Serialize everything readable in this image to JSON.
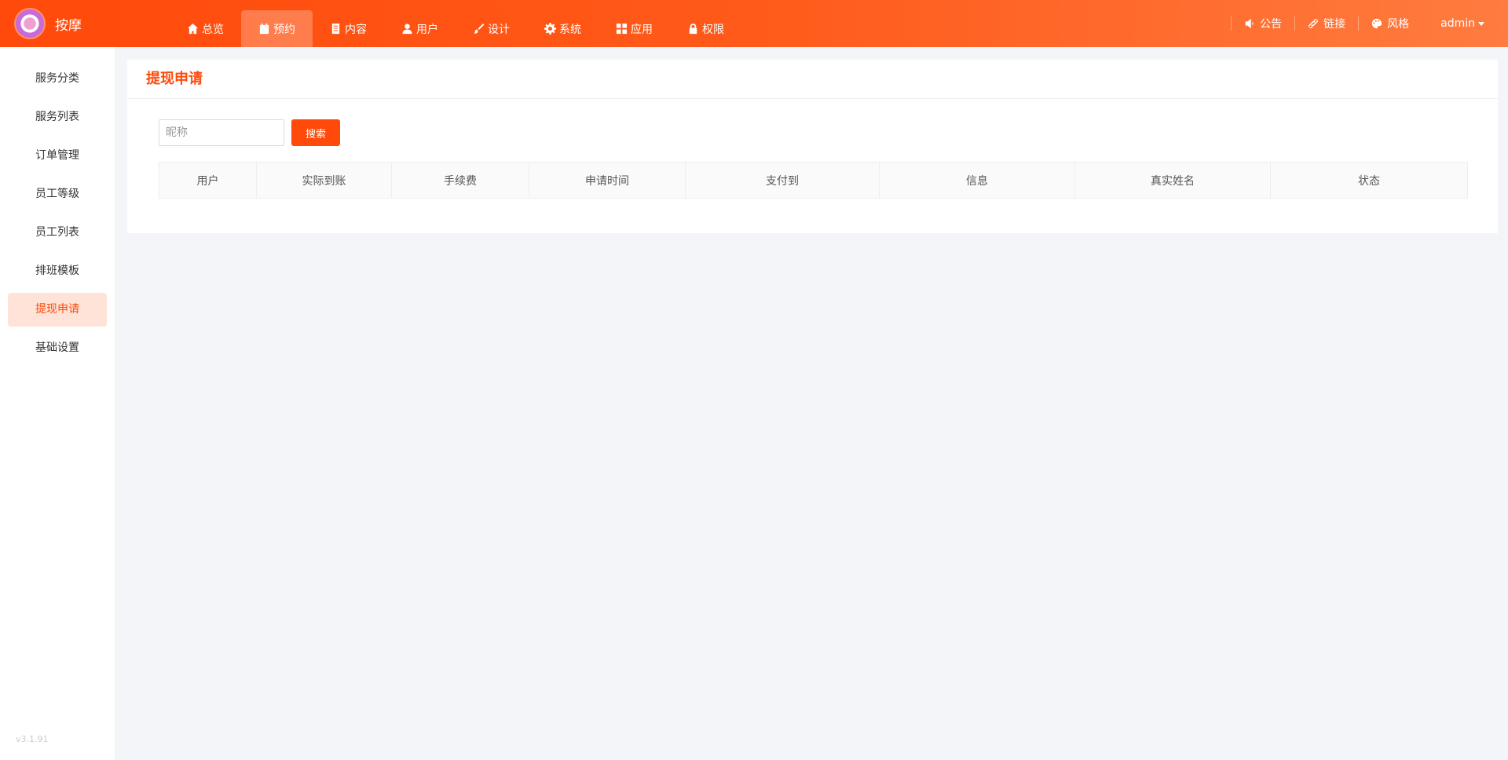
{
  "header": {
    "brand": "按摩",
    "nav": [
      {
        "label": "总览",
        "icon": "home-icon"
      },
      {
        "label": "预约",
        "icon": "calendar-icon",
        "active": true
      },
      {
        "label": "内容",
        "icon": "document-icon"
      },
      {
        "label": "用户",
        "icon": "user-icon"
      },
      {
        "label": "设计",
        "icon": "brush-icon"
      },
      {
        "label": "系统",
        "icon": "gear-icon"
      },
      {
        "label": "应用",
        "icon": "grid-icon"
      },
      {
        "label": "权限",
        "icon": "lock-icon"
      }
    ],
    "right": [
      {
        "label": "公告",
        "icon": "speaker-icon"
      },
      {
        "label": "链接",
        "icon": "link-icon"
      },
      {
        "label": "风格",
        "icon": "palette-icon"
      }
    ],
    "user": "admin"
  },
  "sidebar": {
    "items": [
      {
        "label": "服务分类"
      },
      {
        "label": "服务列表"
      },
      {
        "label": "订单管理"
      },
      {
        "label": "员工等级"
      },
      {
        "label": "员工列表"
      },
      {
        "label": "排班模板"
      },
      {
        "label": "提现申请",
        "active": true
      },
      {
        "label": "基础设置"
      }
    ],
    "version": "v3.1.91"
  },
  "main": {
    "title": "提现申请",
    "search": {
      "placeholder": "昵称",
      "value": "",
      "button": "搜索"
    },
    "table": {
      "columns": [
        "用户",
        "实际到账",
        "手续费",
        "申请时间",
        "支付到",
        "信息",
        "真实姓名",
        "状态"
      ]
    }
  },
  "colors": {
    "accent": "#ff4a0b",
    "active_bg": "#ffe3d8",
    "page_bg": "#f4f5f9"
  }
}
